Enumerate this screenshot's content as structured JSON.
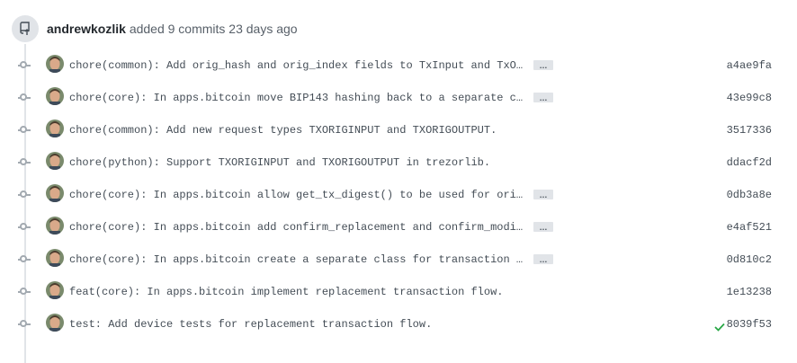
{
  "header": {
    "author": "andrewkozlik",
    "action": "added 9 commits 23 days ago"
  },
  "commits": [
    {
      "message": "chore(common): Add orig_hash and orig_index fields to TxInput and TxO…",
      "sha": "a4ae9fa",
      "expandable": true,
      "status": ""
    },
    {
      "message": "chore(core): In apps.bitcoin move BIP143 hashing back to a separate c…",
      "sha": "43e99c8",
      "expandable": true,
      "status": ""
    },
    {
      "message": "chore(common): Add new request types TXORIGINPUT and TXORIGOUTPUT.",
      "sha": "3517336",
      "expandable": false,
      "status": ""
    },
    {
      "message": "chore(python): Support TXORIGINPUT and TXORIGOUTPUT in trezorlib.",
      "sha": "ddacf2d",
      "expandable": false,
      "status": ""
    },
    {
      "message": "chore(core): In apps.bitcoin allow get_tx_digest() to be used for ori…",
      "sha": "0db3a8e",
      "expandable": true,
      "status": ""
    },
    {
      "message": "chore(core): In apps.bitcoin add confirm_replacement and confirm_modi…",
      "sha": "e4af521",
      "expandable": true,
      "status": ""
    },
    {
      "message": "chore(core): In apps.bitcoin create a separate class for transaction …",
      "sha": "0d810c2",
      "expandable": true,
      "status": ""
    },
    {
      "message": "feat(core): In apps.bitcoin implement replacement transaction flow.",
      "sha": "1e13238",
      "expandable": false,
      "status": ""
    },
    {
      "message": "test: Add device tests for replacement transaction flow.",
      "sha": "8039f53",
      "expandable": false,
      "status": "success"
    }
  ],
  "ellipsis_label": "…",
  "icons": {
    "push": "repo-push-icon",
    "commit": "git-commit-icon",
    "check": "check-icon"
  },
  "colors": {
    "check": "#28a745",
    "badge_bg": "#e1e4e8"
  }
}
